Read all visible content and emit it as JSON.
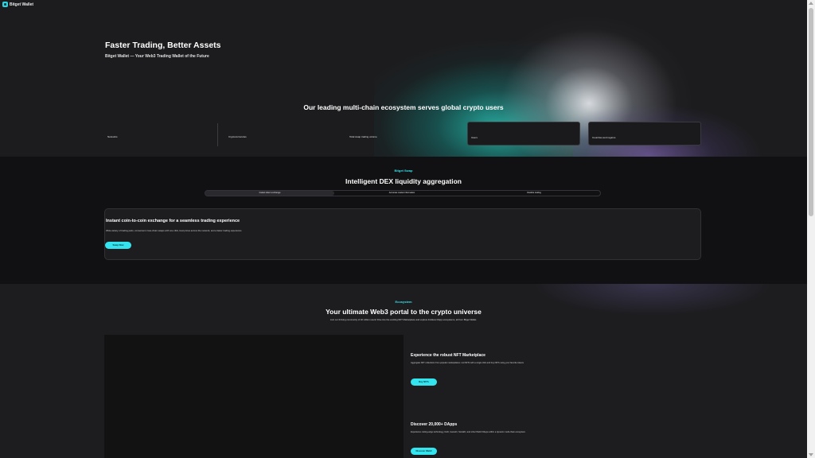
{
  "header": {
    "logo_text": "Bitget Wallet",
    "logo_icon": "bitget-logo-icon"
  },
  "hero": {
    "title": "Faster Trading, Better Assets",
    "subtitle": "Bitget Wallet — Your Web3 Trading Wallet of the Future",
    "ecosystem_title": "Our leading multi-chain ecosystem serves global crypto users",
    "stats": [
      {
        "label": "Networks"
      },
      {
        "label": "Cryptocurrencies"
      },
      {
        "label": "Total swap trading volume"
      },
      {
        "label": "Users"
      },
      {
        "label": "Countries and regions"
      }
    ]
  },
  "swap": {
    "eyebrow": "Bitget Swap",
    "title": "Intelligent DEX liquidity aggregation",
    "tabs": [
      {
        "label": "Instant token exchange",
        "active": true
      },
      {
        "label": "Accurate market information",
        "active": false
      },
      {
        "label": "Flexible trading",
        "active": false
      }
    ],
    "card_title": "Instant coin-to-coin exchange for a seamless trading experience",
    "card_desc": "Wide variety of trading pairs, convenient cross-chain swaps with one click, best prices across the network, and a faster trading experience",
    "button": "Swap Now"
  },
  "ecosystem": {
    "eyebrow": "Ecosystem",
    "title": "Your ultimate Web3 portal to the crypto universe",
    "desc": "Join our thriving community of 40 million users! Dive into the exciting NFT Marketplace and explore limitless DApp ecosystems, all from Bitget Wallet.",
    "features": [
      {
        "title": "Experience the robust NFT Marketplace",
        "desc": "Aggregate NFT collections from popular marketplaces. List NFTs with a single click and buy NFTs using your favorite tokens",
        "button": "Buy NFTs"
      },
      {
        "title": "Discover 20,000+ DApps",
        "desc": "Experience cutting-edge technology, DeFi, GameFi, SocialFi, and other Web3 DApps within a dynamic multi-chain ecosystem.",
        "button": "Discover Web3"
      }
    ]
  },
  "colors": {
    "accent": "#34e4ee",
    "background": "#1b1b1d"
  }
}
